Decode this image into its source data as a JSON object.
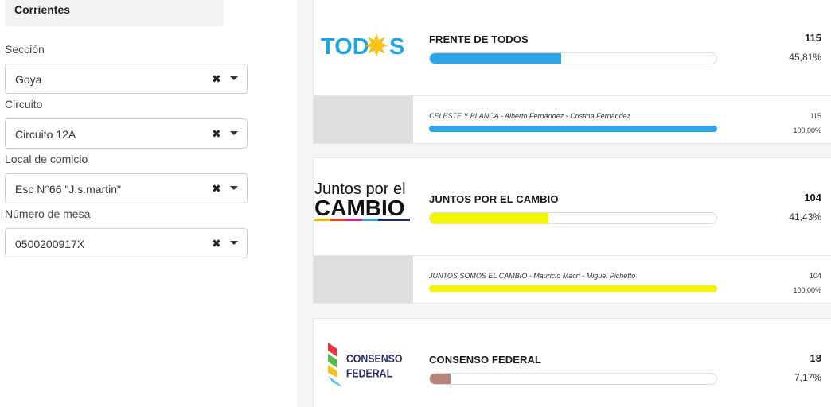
{
  "filters": {
    "province": "Corrientes",
    "fields": [
      {
        "label": "Sección",
        "value": "Goya"
      },
      {
        "label": "Circuito",
        "value": "Circuito 12A"
      },
      {
        "label": "Local de comicio",
        "value": "Esc N°66 \"J.s.martin\""
      },
      {
        "label": "Número de mesa",
        "value": "0500200917X"
      }
    ],
    "clear_icon": "✖"
  },
  "parties": [
    {
      "name": "FRENTE DE TODOS",
      "votes": "115",
      "percent": "45,81%",
      "share": 0.4581,
      "color": "#2ea3e8",
      "logo_text_a": "TOD",
      "logo_text_b": "S",
      "list": {
        "name": "CELESTE Y BLANCA - Alberto Fernández - Cristina Fernández",
        "votes": "115",
        "percent": "100,00%",
        "share": 1.0
      }
    },
    {
      "name": "JUNTOS POR EL CAMBIO",
      "votes": "104",
      "percent": "41,43%",
      "share": 0.4143,
      "color": "#f5f500",
      "logo_line1": "Juntos por el",
      "logo_line2": "CAMBIO",
      "list": {
        "name": "JUNTOS SOMOS EL CAMBIO - Mauricio Macri - Miguel Pichetto",
        "votes": "104",
        "percent": "100,00%",
        "share": 1.0
      }
    },
    {
      "name": "CONSENSO FEDERAL",
      "votes": "18",
      "percent": "7,17%",
      "share": 0.0717,
      "color": "#b5857a",
      "logo_line1": "CONSENSO",
      "logo_line2": "FEDERAL"
    }
  ]
}
